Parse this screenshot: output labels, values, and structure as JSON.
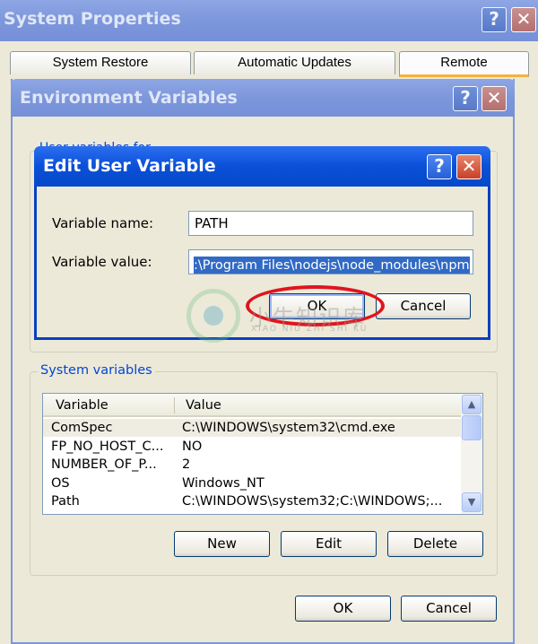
{
  "system_properties": {
    "title": "System Properties",
    "tabs": [
      "System Restore",
      "Automatic Updates",
      "Remote"
    ]
  },
  "env_vars": {
    "title": "Environment Variables",
    "user_group_label": "User variables for ...",
    "system_group_label": "System variables",
    "columns": [
      "Variable",
      "Value"
    ],
    "rows": [
      {
        "variable": "ComSpec",
        "value": "C:\\WINDOWS\\system32\\cmd.exe"
      },
      {
        "variable": "FP_NO_HOST_C...",
        "value": "NO"
      },
      {
        "variable": "NUMBER_OF_P...",
        "value": "2"
      },
      {
        "variable": "OS",
        "value": "Windows_NT"
      },
      {
        "variable": "Path",
        "value": "C:\\WINDOWS\\system32;C:\\WINDOWS;..."
      }
    ],
    "buttons": {
      "new": "New",
      "edit": "Edit",
      "delete": "Delete",
      "ok": "OK",
      "cancel": "Cancel"
    }
  },
  "edit_dialog": {
    "title": "Edit User Variable",
    "name_label": "Variable name:",
    "name_value": "PATH",
    "value_label": "Variable value:",
    "value_value": ":\\Program Files\\nodejs\\node_modules\\npm",
    "ok": "OK",
    "cancel": "Cancel"
  },
  "titlebar_buttons": {
    "help": "?",
    "close": "✕"
  },
  "watermark": {
    "text": "小牛知识库",
    "subtext": "XIAO NIU ZHI SHI KU"
  },
  "colors": {
    "highlight": "#316ac5",
    "annotation": "#e0141e",
    "titlebar_active": "#0a50d8"
  }
}
